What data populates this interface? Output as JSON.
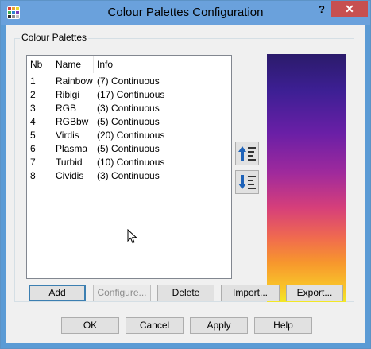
{
  "window": {
    "title": "Colour Palettes Configuration",
    "help_glyph": "?",
    "close_glyph": "✕"
  },
  "group": {
    "title": "Colour Palettes"
  },
  "table": {
    "columns": [
      "Nb",
      "Name",
      "Info"
    ],
    "rows": [
      {
        "nb": "1",
        "name": "Rainbow",
        "info": "(7) Continuous"
      },
      {
        "nb": "2",
        "name": "Ribigi",
        "info": "(17) Continuous"
      },
      {
        "nb": "3",
        "name": "RGB",
        "info": "(3) Continuous"
      },
      {
        "nb": "4",
        "name": "RGBbw",
        "info": "(5) Continuous"
      },
      {
        "nb": "5",
        "name": "Virdis",
        "info": "(20) Continuous"
      },
      {
        "nb": "6",
        "name": "Plasma",
        "info": "(5) Continuous"
      },
      {
        "nb": "7",
        "name": "Turbid",
        "info": "(10) Continuous"
      },
      {
        "nb": "8",
        "name": "Cividis",
        "info": "(3) Continuous"
      }
    ]
  },
  "palette_buttons": {
    "add": "Add",
    "configure": "Configure...",
    "delete": "Delete",
    "import": "Import...",
    "export": "Export..."
  },
  "dialog_buttons": {
    "ok": "OK",
    "cancel": "Cancel",
    "apply": "Apply",
    "help": "Help"
  },
  "icons": {
    "app": "palette-app-icon",
    "move_up": "move-up-icon",
    "move_down": "move-down-icon",
    "cursor": "mouse-cursor-icon"
  },
  "colors": {
    "titlebar": "#6aa1dc",
    "close": "#c75050",
    "preview_top": "#2b1b6b",
    "preview_bottom": "#f2e826"
  }
}
